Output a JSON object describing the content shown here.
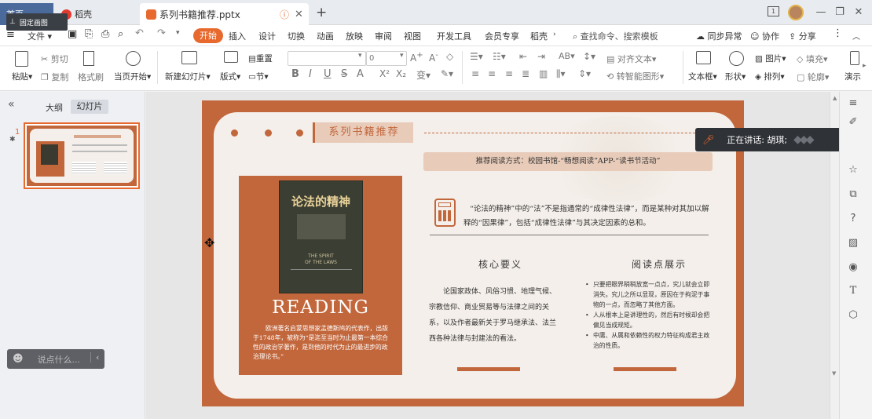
{
  "window": {
    "home_tab": "首页",
    "pin_tooltip": "固定画图",
    "daoke_tab": "稻壳",
    "doc_tab": "系列书籍推荐.pptx",
    "new_tab_icon": "plus-icon"
  },
  "menubar": {
    "file": "文件",
    "items": [
      "开始",
      "插入",
      "设计",
      "切换",
      "动画",
      "放映",
      "审阅",
      "视图",
      "开发工具",
      "会员专享",
      "稻壳"
    ],
    "search_placeholder": "查找命令、搜索模板",
    "sync": "同步异常",
    "collab": "协作",
    "share": "分享"
  },
  "ribbon": {
    "paste": "粘贴",
    "cut": "剪切",
    "copy": "复制",
    "format_painter": "格式刷",
    "from_current": "当页开始",
    "new_slide": "新建幻灯片",
    "layout": "版式",
    "section": "节",
    "reset": "重置",
    "font_size": "0",
    "align_text": "对齐文本",
    "smart_art": "转智能图形",
    "textbox": "文本框",
    "shape": "形状",
    "arrange": "排列",
    "picture": "图片",
    "fill": "填充",
    "outline": "轮廓",
    "play": "演示"
  },
  "leftpanel": {
    "outline_tab": "大纲",
    "slides_tab": "幻灯片",
    "slide_number": "1",
    "comment_placeholder": "说点什么..."
  },
  "slide": {
    "title": "系列书籍推荐",
    "subtitle": "推荐阅读方式：校园书馆-“畅想阅读”APP-“读书节活动”",
    "book_title": "论法的精神",
    "book_sub_en1": "THE SPIRIT",
    "book_sub_en2": "OF THE LAWS",
    "reading_label": "READING",
    "book_desc": "欧洲著名启蒙思想家孟德斯鸠的代表作，出版于1748年，被称为“是迄至当时为止最第一本综合性的政治学著作，是到他的时代为止的最进步的政治理论书。”",
    "quote": "“论法的精神”中的“法”不是指通常的“成律性法律”，而是某种对其加以解释的“因果律”，包括“成律性法律”与其决定因素的总和。",
    "col1_title": "核心要义",
    "col1_body": "论国家政体、风俗习惯、地理气候、宗教信仰、商业贸易等与法律之间的关系，以及作者最新关于罗马继承法、法兰西各种法律与封建法的看法。",
    "col2_title": "阅读点展示",
    "col2_items": [
      "只要把眼界稍稍放宽一点点，究儿就会立即消失。究儿之所以显现，原因在于拘泥于事物的一点，而忽略了其他方面。",
      "人从根本上是讲理性的，然后有时候却会把偏见当成规矩。",
      "中庸、从属和依赖性的权力特征构成君主政治的性质。"
    ]
  },
  "speaking": {
    "label": "正在讲话: 胡琪;"
  },
  "colors": {
    "accent": "#c2673c",
    "menu_active": "#e8692e",
    "slide_bg": "#f4efea"
  }
}
